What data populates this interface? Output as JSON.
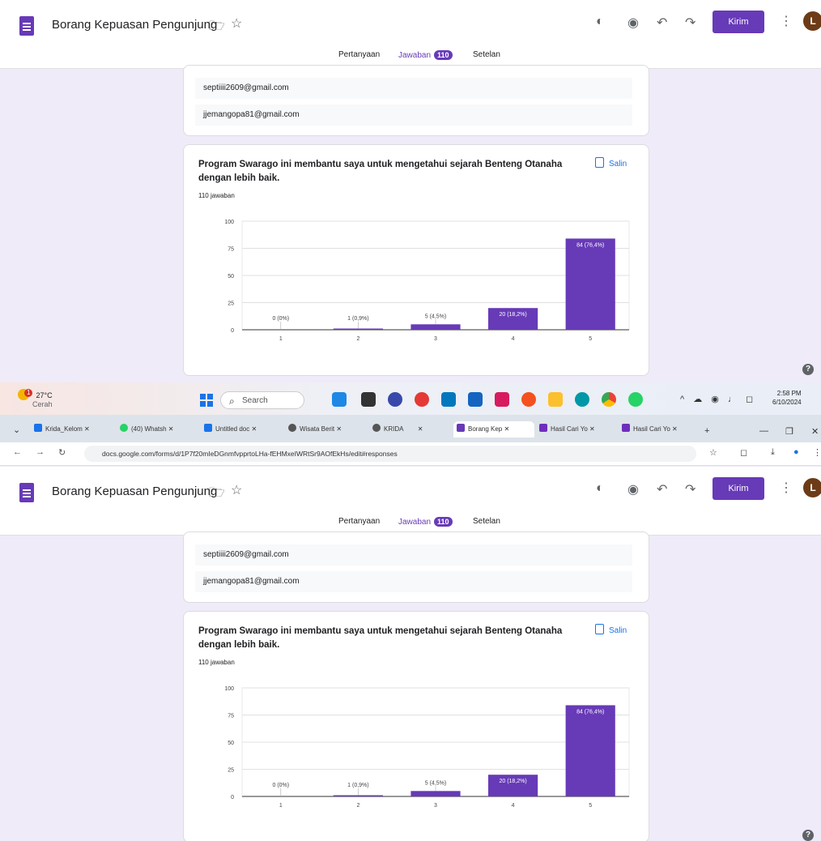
{
  "form": {
    "title": "Borang Kepuasan Pengunjung",
    "send_label": "Kirim",
    "avatar_letter": "L",
    "tabs": [
      {
        "label": "Pertanyaan"
      },
      {
        "label": "Jawaban",
        "badge": "110"
      },
      {
        "label": "Setelan"
      }
    ],
    "emails": [
      "septiiii2609@gmail.com",
      "jjemangopa81@gmail.com"
    ],
    "question": {
      "title": "Program Swarago ini membantu saya untuk mengetahui sejarah Benteng Otanaha dengan lebih baik.",
      "count": "110 jawaban",
      "copy_label": "Salin"
    },
    "help_label": "?"
  },
  "colors": {
    "brand": "#673ab7",
    "link": "#1a73e8"
  },
  "icons": {
    "toolbar": [
      "palette-icon",
      "preview-eye-icon",
      "undo-icon",
      "redo-icon"
    ],
    "folder": "folder-icon",
    "star": "star-icon"
  },
  "chart_data": {
    "type": "bar",
    "categories": [
      "1",
      "2",
      "3",
      "4",
      "5"
    ],
    "values": [
      0,
      1,
      5,
      20,
      84
    ],
    "data_labels": [
      "0 (0%)",
      "1 (0,9%)",
      "5 (4,5%)",
      "20 (18,2%)",
      "84 (76,4%)"
    ],
    "yticks": [
      "0",
      "25",
      "50",
      "75",
      "100"
    ],
    "ylim": [
      0,
      100
    ],
    "grid": true,
    "color": "#673ab7"
  },
  "taskbar": {
    "weather_temp": "27°C",
    "weather_desc": "Cerah",
    "weather_badge": "1",
    "search_label": "Search",
    "time": "2:58 PM",
    "date": "6/10/2024"
  },
  "browser": {
    "tabs": [
      {
        "label": "Krida_Kelom",
        "color": "#1a73e8"
      },
      {
        "label": "(40) Whatsh",
        "color": "#25d366"
      },
      {
        "label": "Untitled doc",
        "color": "#1a73e8"
      },
      {
        "label": "Wisata Berit",
        "color": "#555555"
      },
      {
        "label": "KRIDA",
        "color": "#555555"
      },
      {
        "label": "Borang Kep",
        "color": "#673ab7"
      },
      {
        "label": "Hasil Cari Yo",
        "color": "#6f2dbd"
      },
      {
        "label": "Hasil Cari Yo",
        "color": "#6f2dbd"
      }
    ],
    "new_tab_label": "+",
    "url": "docs.google.com/forms/d/1P7f20mIeDGnmfvpprtoLHa-fEHMxeIWRtSr9AOfEkHs/edit#responses"
  }
}
